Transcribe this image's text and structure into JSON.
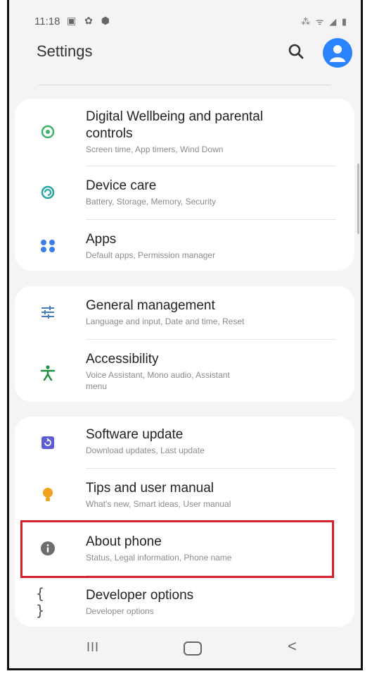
{
  "status": {
    "time": "11:18",
    "left_icons": "▣ ✿ ⬢",
    "right_icons": "⁂ ᯤ ◢ ▮"
  },
  "header": {
    "title": "Settings"
  },
  "groups": [
    {
      "items": [
        {
          "label_line1": "Digital Wellbeing and parental",
          "label_line2": "controls",
          "sub": "Screen time, App timers, Wind Down",
          "icon": "digital-wellbeing-icon",
          "color": "#3db36b"
        },
        {
          "label": "Device care",
          "sub": "Battery, Storage, Memory, Security",
          "icon": "device-care-icon",
          "color": "#1fa7a0"
        },
        {
          "label": "Apps",
          "sub": "Default apps, Permission manager",
          "icon": "apps-icon",
          "color": "#3b7de9"
        }
      ]
    },
    {
      "items": [
        {
          "label": "General management",
          "sub": "Language and input, Date and time, Reset",
          "icon": "sliders-icon",
          "color": "#4a7bbf"
        },
        {
          "label": "Accessibility",
          "sub_line1": "Voice Assistant, Mono audio, Assistant",
          "sub_line2": "menu",
          "icon": "accessibility-icon",
          "color": "#1e8f3a"
        }
      ]
    },
    {
      "items": [
        {
          "label": "Software update",
          "sub": "Download updates, Last update",
          "icon": "software-update-icon",
          "color": "#5b5bd6"
        },
        {
          "label": "Tips and user manual",
          "sub": "What's new, Smart ideas, User manual",
          "icon": "lightbulb-icon",
          "color": "#f0a21e"
        },
        {
          "label": "About phone",
          "sub": "Status, Legal information, Phone name",
          "icon": "info-icon",
          "color": "#6d6d6d"
        },
        {
          "label": "Developer options",
          "sub": "Developer options",
          "icon": "braces-icon",
          "color": "#555555"
        }
      ]
    }
  ],
  "nav": {
    "recent": "III",
    "back": "<"
  }
}
